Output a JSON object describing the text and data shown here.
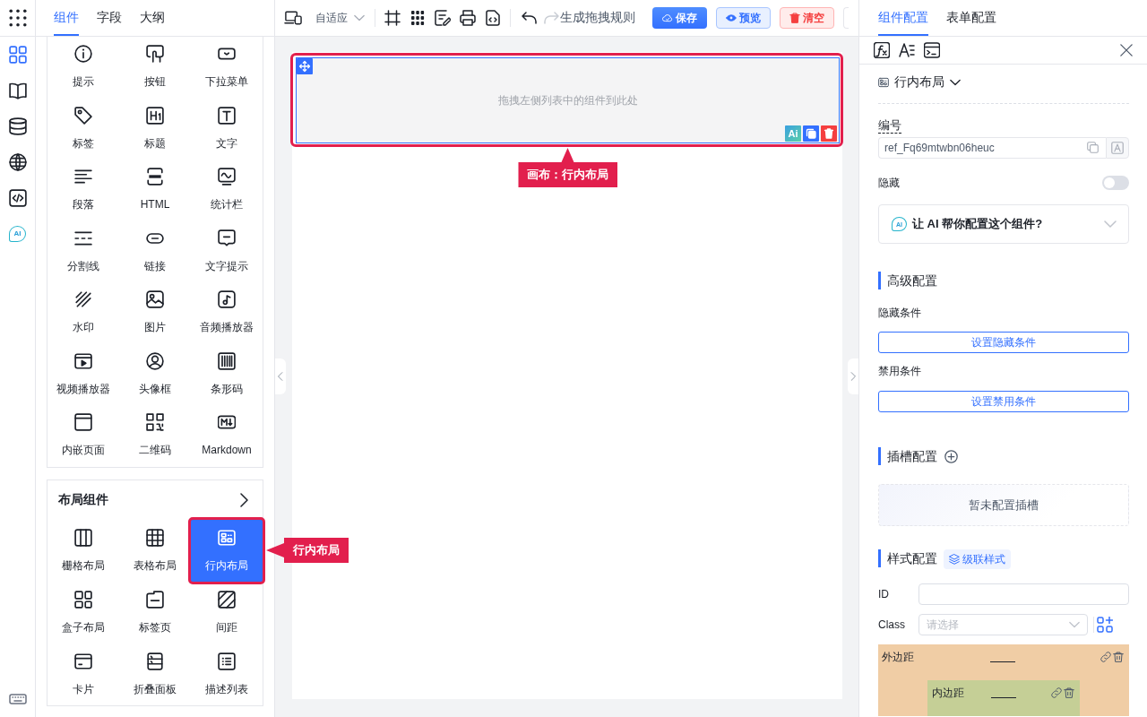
{
  "rail": {
    "items": [
      {
        "kind": "components",
        "selected": true
      },
      {
        "kind": "book",
        "selected": false
      },
      {
        "kind": "database",
        "selected": false
      },
      {
        "kind": "globe",
        "selected": false
      },
      {
        "kind": "code",
        "selected": false
      },
      {
        "kind": "ai",
        "label": "AI",
        "selected": false
      }
    ]
  },
  "component_panel": {
    "tabs": [
      {
        "label": "组件",
        "selected": true
      },
      {
        "label": "字段",
        "selected": false
      },
      {
        "label": "大纲",
        "selected": false
      }
    ],
    "groups": [
      {
        "items": [
          {
            "kind": "tip",
            "label": "提示",
            "selected": false
          },
          {
            "kind": "button",
            "label": "按钮",
            "selected": false
          },
          {
            "kind": "dropdown",
            "label": "下拉菜单",
            "selected": false
          },
          {
            "kind": "tag",
            "label": "标签",
            "selected": false
          },
          {
            "kind": "heading",
            "label": "标题",
            "selected": false
          },
          {
            "kind": "text",
            "label": "文字",
            "selected": false
          },
          {
            "kind": "paragraph",
            "label": "段落",
            "selected": false
          },
          {
            "kind": "html",
            "label": "HTML",
            "selected": false
          },
          {
            "kind": "statistic",
            "label": "统计栏",
            "selected": false
          },
          {
            "kind": "divider",
            "label": "分割线",
            "selected": false
          },
          {
            "kind": "link",
            "label": "链接",
            "selected": false
          },
          {
            "kind": "tooltip",
            "label": "文字提示",
            "selected": false
          },
          {
            "kind": "watermark",
            "label": "水印",
            "selected": false
          },
          {
            "kind": "image",
            "label": "图片",
            "selected": false
          },
          {
            "kind": "audio",
            "label": "音频播放器",
            "selected": false
          },
          {
            "kind": "video",
            "label": "视频播放器",
            "selected": false
          },
          {
            "kind": "avatar",
            "label": "头像框",
            "selected": false
          },
          {
            "kind": "barcode",
            "label": "条形码",
            "selected": false
          },
          {
            "kind": "iframe",
            "label": "内嵌页面",
            "selected": false
          },
          {
            "kind": "qrcode",
            "label": "二维码",
            "selected": false
          },
          {
            "kind": "markdown",
            "label": "Markdown",
            "selected": false
          }
        ]
      },
      {
        "title": "布局组件",
        "items": [
          {
            "kind": "grid",
            "label": "栅格布局",
            "selected": false
          },
          {
            "kind": "table",
            "label": "表格布局",
            "selected": false
          },
          {
            "kind": "inline",
            "label": "行内布局",
            "selected": true,
            "callout": "行内布局"
          },
          {
            "kind": "box",
            "label": "盒子布局",
            "selected": false
          },
          {
            "kind": "tabs",
            "label": "标签页",
            "selected": false
          },
          {
            "kind": "spacing",
            "label": "间距",
            "selected": false
          },
          {
            "kind": "card",
            "label": "卡片",
            "selected": false
          },
          {
            "kind": "collapse",
            "label": "折叠面板",
            "selected": false
          },
          {
            "kind": "descriptions",
            "label": "描述列表",
            "selected": false
          }
        ]
      }
    ]
  },
  "toolbar": {
    "device": {
      "value": "自适应"
    },
    "undo": {
      "disabled": false
    },
    "redo": {
      "disabled": true
    },
    "rules": {
      "label": "生成拖拽规则"
    },
    "buttons": [
      {
        "kind": "primary",
        "label": "保存"
      },
      {
        "kind": "info",
        "label": "预览"
      },
      {
        "kind": "danger",
        "label": "清空"
      },
      {
        "kind": "partial"
      }
    ]
  },
  "canvas": {
    "container": {
      "selected": true,
      "hint": "拖拽左侧列表中的组件到此处",
      "actions": [
        {
          "kind": "ai",
          "label": "Ai"
        },
        {
          "kind": "copy"
        },
        {
          "kind": "delete"
        }
      ],
      "callout": "画布：行内布局"
    }
  },
  "config_panel": {
    "tabs": [
      {
        "label": "组件配置",
        "selected": true
      },
      {
        "label": "表单配置",
        "selected": false
      }
    ],
    "component": {
      "value": "行内布局"
    },
    "ref": {
      "label": "编号",
      "value": "ref_Fq69mtwbn06heuc"
    },
    "hidden": {
      "label": "隐藏",
      "on": false
    },
    "ai_assist": {
      "badge": "AI",
      "text": "让 AI 帮你配置这个组件?",
      "expanded": false
    },
    "advanced": {
      "title": "高级配置",
      "conditions": [
        {
          "label": "隐藏条件",
          "button": "设置隐藏条件"
        },
        {
          "label": "禁用条件",
          "button": "设置禁用条件"
        }
      ]
    },
    "slots": {
      "title": "插槽配置",
      "empty": "暂未配置插槽"
    },
    "style": {
      "title": "样式配置",
      "tag": "级联样式",
      "id": {
        "label": "ID"
      },
      "class": {
        "label": "Class",
        "placeholder": "请选择"
      },
      "box_model": {
        "margin": "外边距",
        "padding": "内边距"
      }
    }
  }
}
